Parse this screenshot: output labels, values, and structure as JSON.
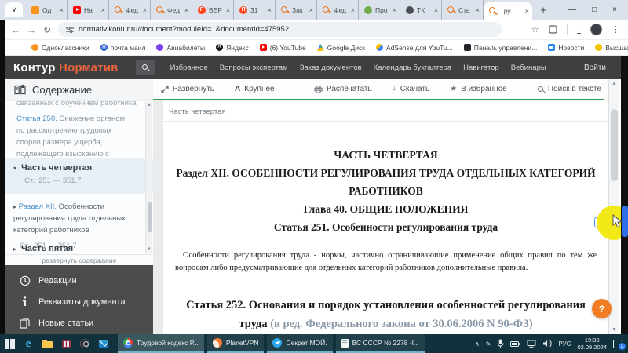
{
  "icons": {
    "tab_chevron": "∨",
    "new_tab": "+",
    "win_min": "—",
    "win_max": "□",
    "win_close": "×",
    "tab_close": "×",
    "nav_back": "←",
    "nav_forward": "→",
    "nav_reload": "↻",
    "bookmark_star": "☆",
    "menu_dots": "⋮",
    "overflow": "»",
    "caret_down": "▾",
    "caret_right": "▸",
    "scroll_up": "▲",
    "scroll_down": "▼",
    "tray_chevron": "∧",
    "pen": "✎",
    "fontsize_a": "A",
    "annot_info": "i",
    "star_filled": "★",
    "download_arrow": "↓",
    "edge_letter": "e"
  },
  "browser": {
    "tabs": [
      {
        "label": "Од",
        "icon": "odnoklassniki"
      },
      {
        "label": "На",
        "icon": "youtube"
      },
      {
        "label": "Фед",
        "icon": "kontur"
      },
      {
        "label": "Фед",
        "icon": "kontur"
      },
      {
        "label": "ВЕР",
        "icon": "yandex"
      },
      {
        "label": "31",
        "icon": "yandex"
      },
      {
        "label": "Зак",
        "icon": "kontur"
      },
      {
        "label": "Фед",
        "icon": "kontur"
      },
      {
        "label": "Про",
        "icon": "green-app"
      },
      {
        "label": "ТК",
        "icon": "dark-app"
      },
      {
        "label": "Ста",
        "icon": "kontur"
      },
      {
        "label": "Тру",
        "icon": "kontur",
        "active": true
      }
    ],
    "url": "normativ.kontur.ru/document?moduleId=1&documentId=475952",
    "bookmarks": [
      {
        "label": "Одноклассники",
        "icon": "odnoklassniki"
      },
      {
        "label": "почта маил",
        "icon": "mail-ru"
      },
      {
        "label": "Авиабилеты",
        "icon": "avia"
      },
      {
        "label": "Яндекс",
        "icon": "yandex"
      },
      {
        "label": "(6) YouTube",
        "icon": "youtube"
      },
      {
        "label": "Google Диск",
        "icon": "google-drive"
      },
      {
        "label": "AdSense для YouTu...",
        "icon": "adsense"
      },
      {
        "label": "Панель управлени...",
        "icon": "panel"
      },
      {
        "label": "Новости",
        "icon": "vk-news"
      },
      {
        "label": "Высшая квалифика...",
        "icon": "qualification"
      }
    ]
  },
  "site_header": {
    "logo_part1": "Контур",
    "logo_part2": "Норматив",
    "nav": [
      "Избранное",
      "Вопросы экспертам",
      "Заказ документов",
      "Календарь бухгалтера",
      "Навигатор",
      "Вебинары"
    ],
    "login": "Войти"
  },
  "sidebar": {
    "title": "Содержание",
    "toc": {
      "truncated_top": "связанных с обучением работника",
      "article250_link": "Статья 250.",
      "article250_text": " Снижение органом по рассмотрению трудовых споров размера ущерба, подлежащего взысканию с работника",
      "part4_label": "Часть четвертая",
      "part4_range": "Ст.: 251 — 351.7",
      "section12_link": "Раздел XII.",
      "section12_text": " Особенности регулирования труда отдельных категорий работников",
      "section12_range": "Ст.: 251 — 351.7",
      "part5_label": "Часть пятая",
      "expand_link": "развернуть содержание"
    },
    "panel": [
      {
        "label": "Редакции",
        "icon": "clock"
      },
      {
        "label": "Реквизиты документа",
        "icon": "info"
      },
      {
        "label": "Новые статьи",
        "icon": "documents"
      }
    ]
  },
  "toolbar": {
    "expand": "Развернуть",
    "zoom": "Крупнее",
    "print": "Распечатать",
    "download": "Скачать",
    "favorite": "В избранное",
    "search": "Поиск в тексте"
  },
  "document": {
    "breadcrumb": "Часть четвертая",
    "heading_lines": [
      "ЧАСТЬ ЧЕТВЕРТАЯ",
      "Раздел XII. ОСОБЕННОСТИ РЕГУЛИРОВАНИЯ ТРУДА ОТДЕЛЬНЫХ КАТЕГОРИЙ РАБОТНИКОВ",
      "Глава 40. ОБЩИЕ ПОЛОЖЕНИЯ",
      "Статья 251. Особенности регулирования труда"
    ],
    "paragraph": "Особенности регулирования труда - нормы, частично ограничивающие применение общих правил по тем же вопросам либо предусматривающие для отдельных категорий работников дополнительные правила.",
    "article252_title": "Статья 252. Основания и порядок установления особенностей регулирования труда",
    "article252_note": " (в ред. Федерального закона от 30.06.2006 N 90-ФЗ)",
    "help_button": "?"
  },
  "taskbar": {
    "tasks": [
      {
        "label": "Трудовой кодекс Р...",
        "icon": "chrome",
        "active": true
      },
      {
        "label": "PlanetVPN",
        "icon": "planetvpn"
      },
      {
        "label": "Секрет МОЙ.",
        "icon": "telegram"
      },
      {
        "label": "ВС СССР № 2278 -I...",
        "icon": "document"
      }
    ],
    "tray": {
      "lang": "РУС",
      "time": "19:33",
      "date": "02.09.2024",
      "badge": "2"
    }
  },
  "colors": {
    "kontur_orange": "#e8643c",
    "link_blue": "#4a8fc9",
    "toolbar_green": "#2f9e52",
    "help_orange": "#f07d23",
    "highlight_yellow": "#f4e918",
    "taskbar_teal": "#11323c"
  }
}
